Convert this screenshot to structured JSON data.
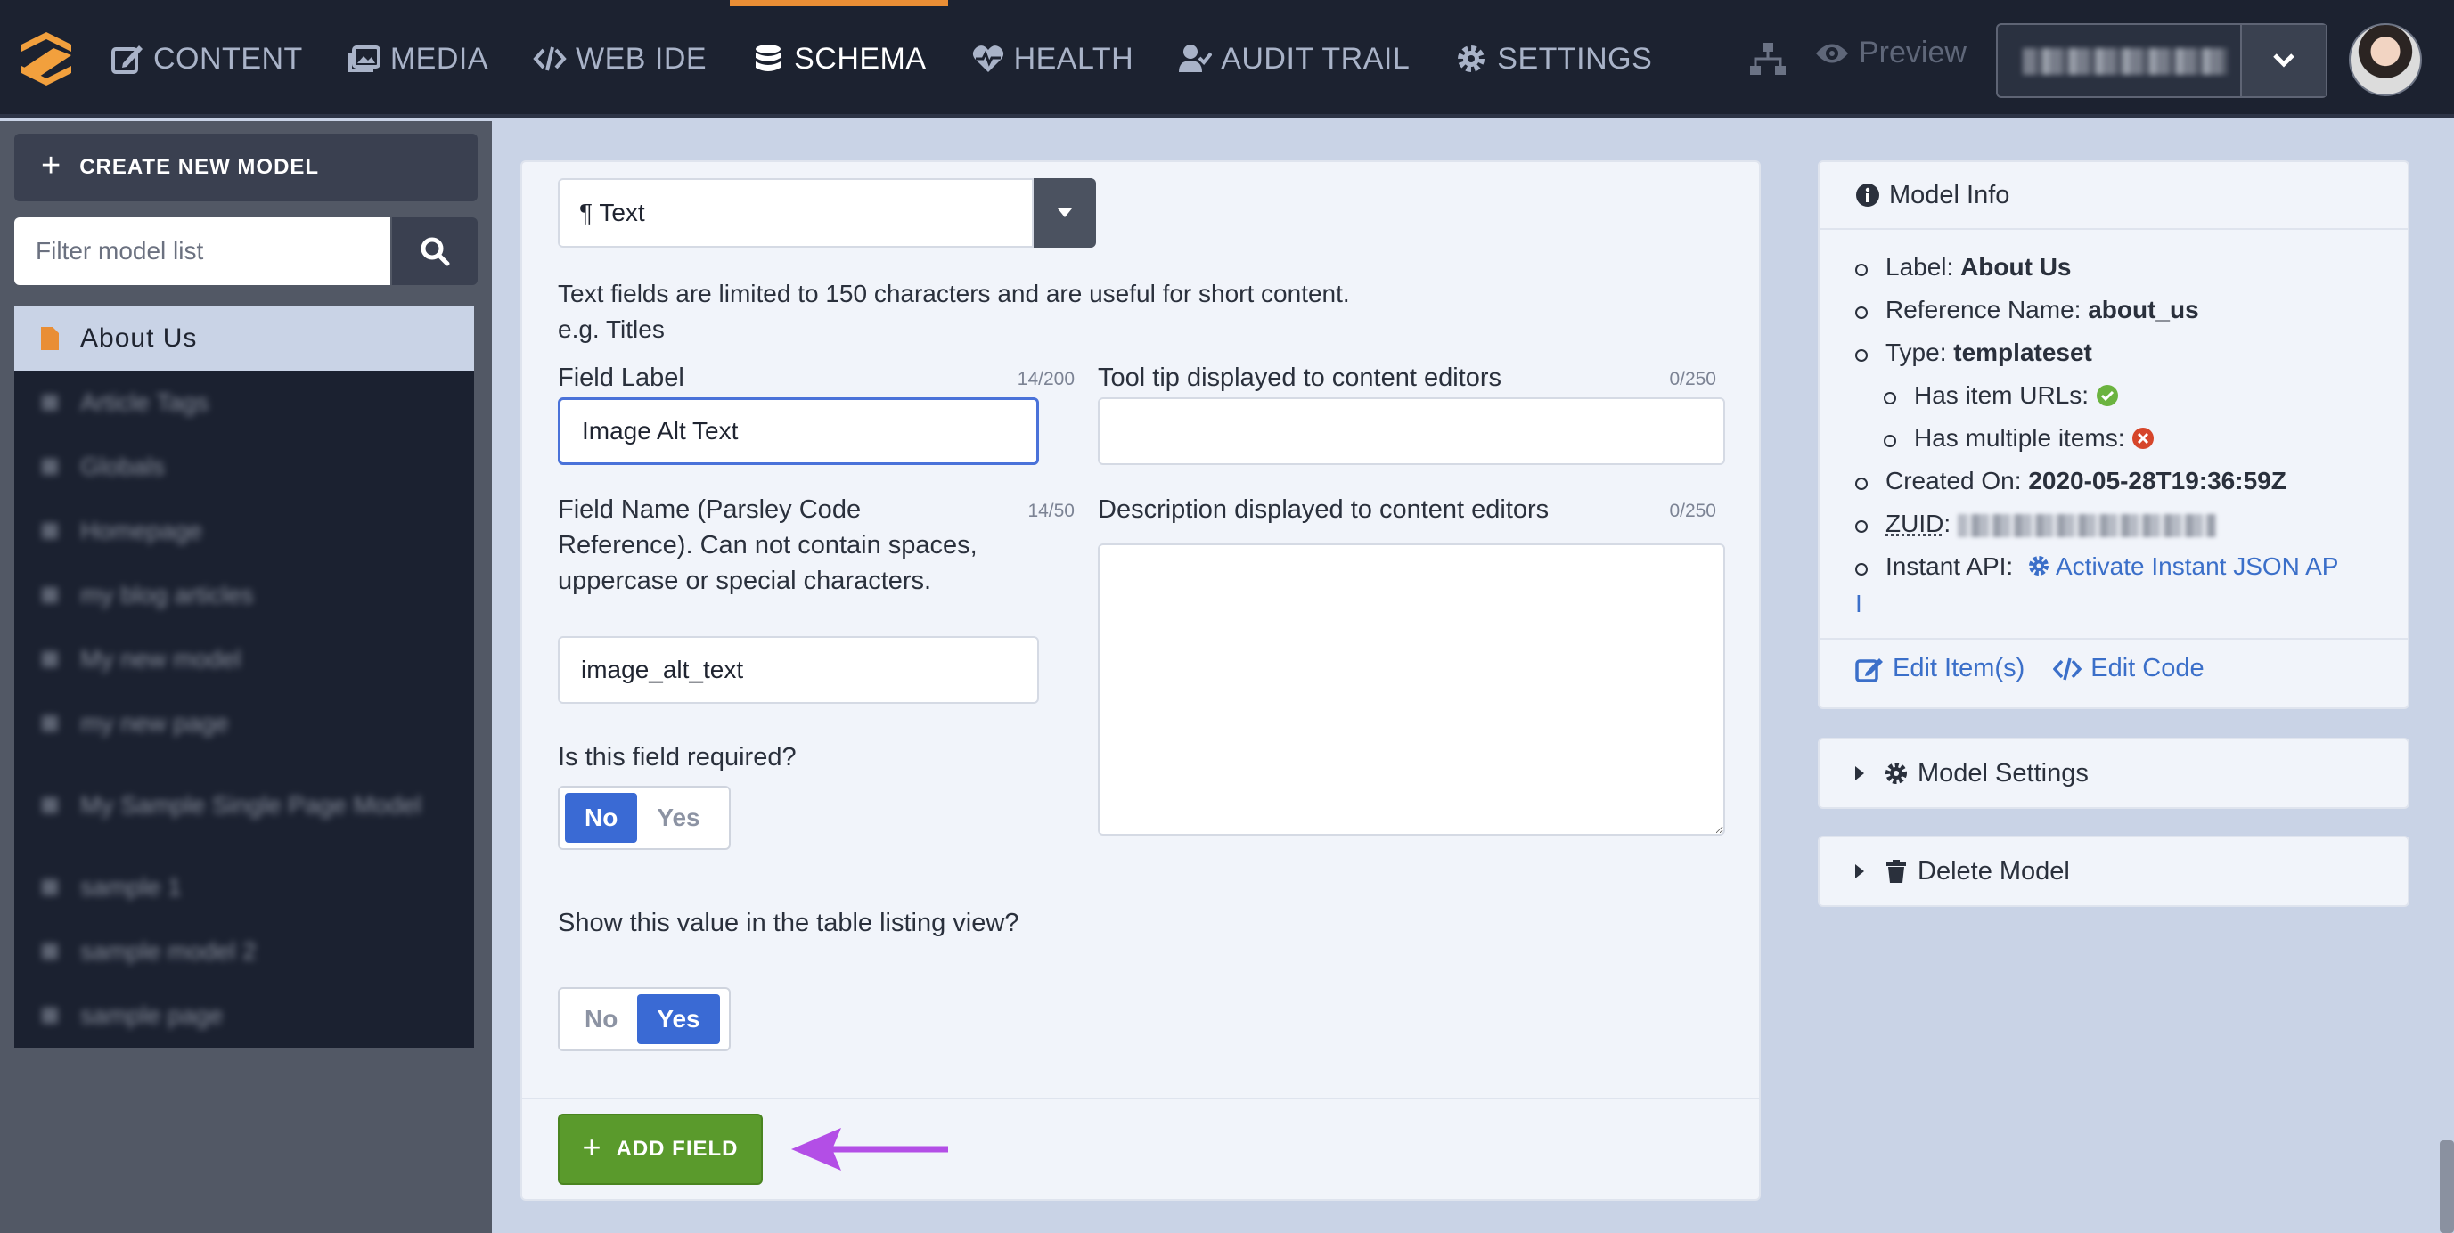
{
  "nav": {
    "items": [
      {
        "label": "CONTENT",
        "icon": "edit-icon"
      },
      {
        "label": "MEDIA",
        "icon": "images-icon"
      },
      {
        "label": "WEB IDE",
        "icon": "code-icon"
      },
      {
        "label": "SCHEMA",
        "icon": "database-icon",
        "active": true
      },
      {
        "label": "HEALTH",
        "icon": "heartbeat-icon"
      },
      {
        "label": "AUDIT TRAIL",
        "icon": "user-check-icon"
      },
      {
        "label": "SETTINGS",
        "icon": "gear-icon"
      }
    ],
    "preview_label": "Preview",
    "accent_color": "#e98e35"
  },
  "sidebar": {
    "create_label": "CREATE NEW MODEL",
    "filter_placeholder": "Filter model list",
    "models": [
      {
        "label": "About Us",
        "active": true
      },
      {
        "label": "Article Tags"
      },
      {
        "label": "Globals"
      },
      {
        "label": "Homepage"
      },
      {
        "label": "my blog articles"
      },
      {
        "label": "My new model"
      },
      {
        "label": "my new page"
      },
      {
        "label": "My Sample Single Page Model"
      },
      {
        "label": "sample 1"
      },
      {
        "label": "sample model 2"
      },
      {
        "label": "sample page"
      }
    ]
  },
  "form": {
    "type_value": "¶ Text",
    "help_line1": "Text fields are limited to 150 characters and are useful for short content.",
    "help_line2": "e.g. Titles",
    "field_label": {
      "label": "Field Label",
      "counter": "14/200",
      "value": "Image Alt Text"
    },
    "tooltip": {
      "label": "Tool tip displayed to content editors",
      "counter": "0/250",
      "value": ""
    },
    "field_name": {
      "label": "Field Name (Parsley Code Reference). Can not contain spaces, uppercase or special characters.",
      "counter": "14/50",
      "value": "image_alt_text"
    },
    "description": {
      "label": "Description displayed to content editors",
      "counter": "0/250",
      "value": ""
    },
    "required": {
      "question": "Is this field required?",
      "no": "No",
      "yes": "Yes",
      "selected": "No"
    },
    "listing": {
      "question": "Show this value in the table listing view?",
      "no": "No",
      "yes": "Yes",
      "selected": "Yes"
    },
    "add_label": "ADD FIELD",
    "add_color": "#5a9a2c"
  },
  "model_info": {
    "title": "Model Info",
    "label_key": "Label:",
    "label_val": "About Us",
    "ref_key": "Reference Name:",
    "ref_val": "about_us",
    "type_key": "Type:",
    "type_val": "templateset",
    "urls_key": "Has item URLs:",
    "multi_key": "Has multiple items:",
    "created_key": "Created On:",
    "created_val": "2020-05-28T19:36:59Z",
    "zuid_key": "ZUID",
    "api_key": "Instant API:",
    "api_link_1": "Activate Instant JSON AP",
    "api_link_2": "I",
    "edit_items": "Edit Item(s)",
    "edit_code": "Edit Code"
  },
  "model_settings_label": "Model Settings",
  "delete_label": "Delete Model"
}
